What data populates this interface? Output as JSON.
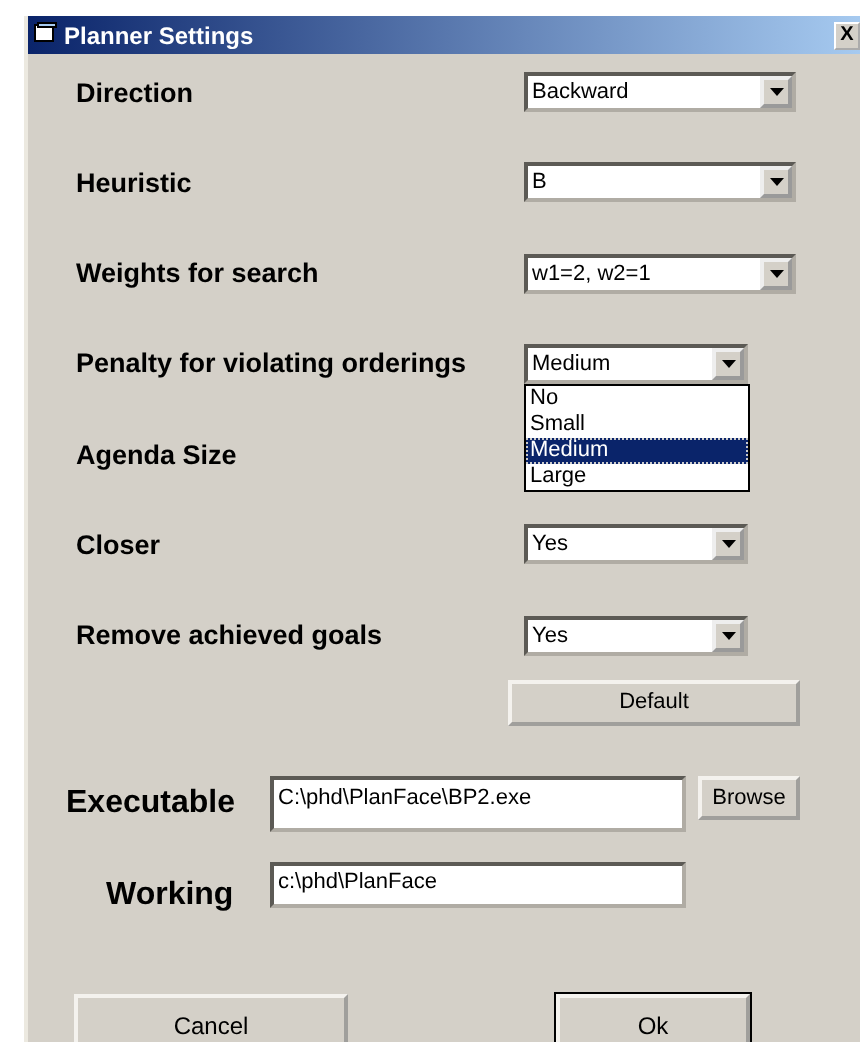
{
  "window": {
    "title": "Planner Settings",
    "close": "X"
  },
  "settings": [
    {
      "kind": "combo",
      "label": "Direction",
      "value": "Backward"
    },
    {
      "kind": "combo",
      "label": "Heuristic",
      "value": "B"
    },
    {
      "kind": "combo",
      "label": "Weights for search",
      "value": "w1=2, w2=1"
    },
    {
      "kind": "combo",
      "label": "Penalty for violating orderings",
      "value": "Medium",
      "expanded": true,
      "options": [
        {
          "label": "No",
          "selected": false
        },
        {
          "label": "Small",
          "selected": false
        },
        {
          "label": "Medium",
          "selected": true
        },
        {
          "label": "Large",
          "selected": false
        }
      ]
    },
    {
      "kind": "label",
      "label": "Agenda Size"
    },
    {
      "kind": "combo",
      "label": "Closer",
      "value": "Yes"
    },
    {
      "kind": "combo",
      "label": "Remove achieved goals",
      "value": "Yes"
    }
  ],
  "default_button": "Default",
  "executable": {
    "label": "Executable",
    "value": "C:\\phd\\PlanFace\\BP2.exe",
    "button": "Browse"
  },
  "working": {
    "label": "Working",
    "value": "c:\\phd\\PlanFace"
  },
  "buttons": {
    "cancel": "Cancel",
    "ok": "Ok"
  }
}
